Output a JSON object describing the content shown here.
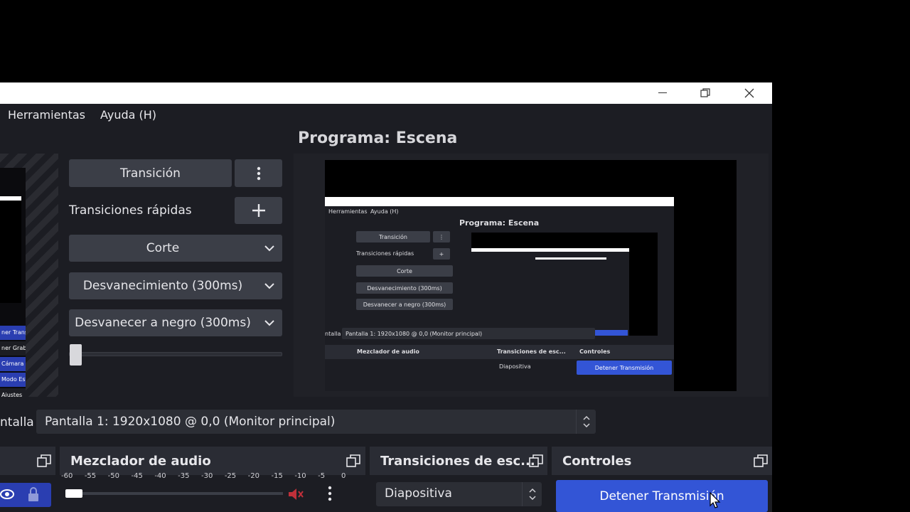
{
  "menu": {
    "tools": "Herramientas",
    "help": "Ayuda (H)"
  },
  "program": {
    "title": "Programa: Escena"
  },
  "transitions": {
    "transition_button": "Transición",
    "quick_label": "Transiciones rápidas",
    "items": [
      "Corte",
      "Desvanecimiento (300ms)",
      "Desvanecer a negro (300ms)"
    ]
  },
  "left_strip": {
    "buttons": [
      "ner Transmi",
      "ner Graba",
      "Cámara Vi",
      "Modo Estu",
      "Ajustes"
    ]
  },
  "source": {
    "label": "ntalla",
    "value": "Pantalla 1: 1920x1080 @ 0,0 (Monitor principal)"
  },
  "docks": {
    "mixer_title": "Mezclador de audio",
    "scene_transitions_title": "Transiciones de esc...",
    "controls_title": "Controles"
  },
  "mixer": {
    "ticks": [
      "-60",
      "-55",
      "-50",
      "-45",
      "-40",
      "-35",
      "-30",
      "-25",
      "-20",
      "-15",
      "-10",
      "-5",
      "0"
    ]
  },
  "scene_transitions": {
    "value": "Diapositiva"
  },
  "controls": {
    "stop_stream": "Detener Transmisión"
  },
  "nested": {
    "menu_tools": "Herramientas",
    "menu_help": "Ayuda (H)",
    "program_title": "Programa: Escena",
    "transition_button": "Transición",
    "quick_label": "Transiciones rápidas",
    "items": [
      "Corte",
      "Desvanecimiento (300ms)",
      "Desvanecer a negro (300ms)"
    ],
    "source_label": "ntalla",
    "source_value": "Pantalla 1: 1920x1080 @ 0,0 (Monitor principal)",
    "mixer_title": "Mezclador de audio",
    "scene_transitions_title": "Transiciones de esc...",
    "controls_title": "Controles",
    "scene_transitions_value": "Diapositiva",
    "stop_stream": "Detener Transmisión"
  },
  "colors": {
    "accent": "#3355d6",
    "panel": "#2a2c34",
    "background": "#1c1d23",
    "button": "#3b3e47",
    "muted_red": "#c0303a"
  }
}
